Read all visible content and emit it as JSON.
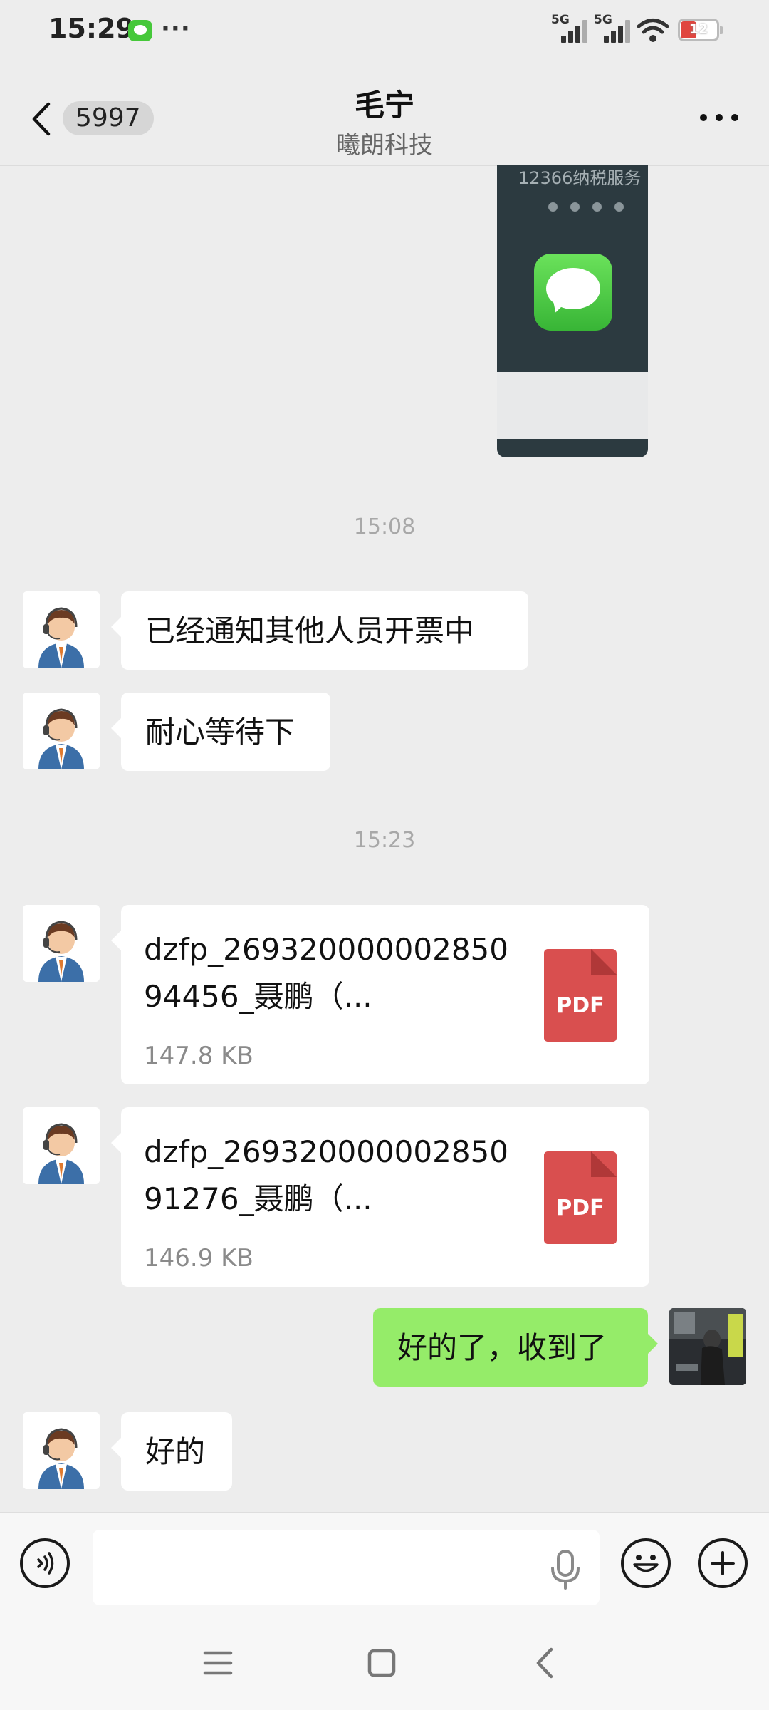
{
  "status_bar": {
    "time": "15:29",
    "overflow": "···",
    "signal1_label": "5G",
    "signal2_label": "5G",
    "battery": "12",
    "icons": [
      "message-app-icon",
      "signal-icon",
      "wifi-icon",
      "battery-icon"
    ]
  },
  "header": {
    "back_count": "5997",
    "title": "毛宁",
    "subtitle": "曦朗科技",
    "icons": [
      "back-arrow-icon",
      "more-icon"
    ]
  },
  "image_message": {
    "top_text": "12366纳税服务"
  },
  "messages": {
    "time1": "15:08",
    "msg1": "已经通知其他人员开票中",
    "msg2": "耐心等待下",
    "time2": "15:23",
    "file1": {
      "name": "dzfp_26932000000285094456_聂鹏（...",
      "size": "147.8 KB",
      "badge": "PDF"
    },
    "file2": {
      "name": "dzfp_26932000000285091276_聂鹏（...",
      "size": "146.9 KB",
      "badge": "PDF"
    },
    "reply": "好的了，收到了",
    "msg3": "好的"
  },
  "input_bar": {
    "placeholder": "",
    "icons": [
      "voice-icon",
      "mic-icon",
      "emoji-icon",
      "plus-icon"
    ]
  },
  "nav_bar": {
    "icons": [
      "menu-icon",
      "home-icon",
      "back-icon"
    ]
  },
  "colors": {
    "background": "#ededed",
    "sent_bubble": "#95ec69",
    "received_bubble": "#ffffff",
    "pdf_icon": "#d94f4f"
  }
}
